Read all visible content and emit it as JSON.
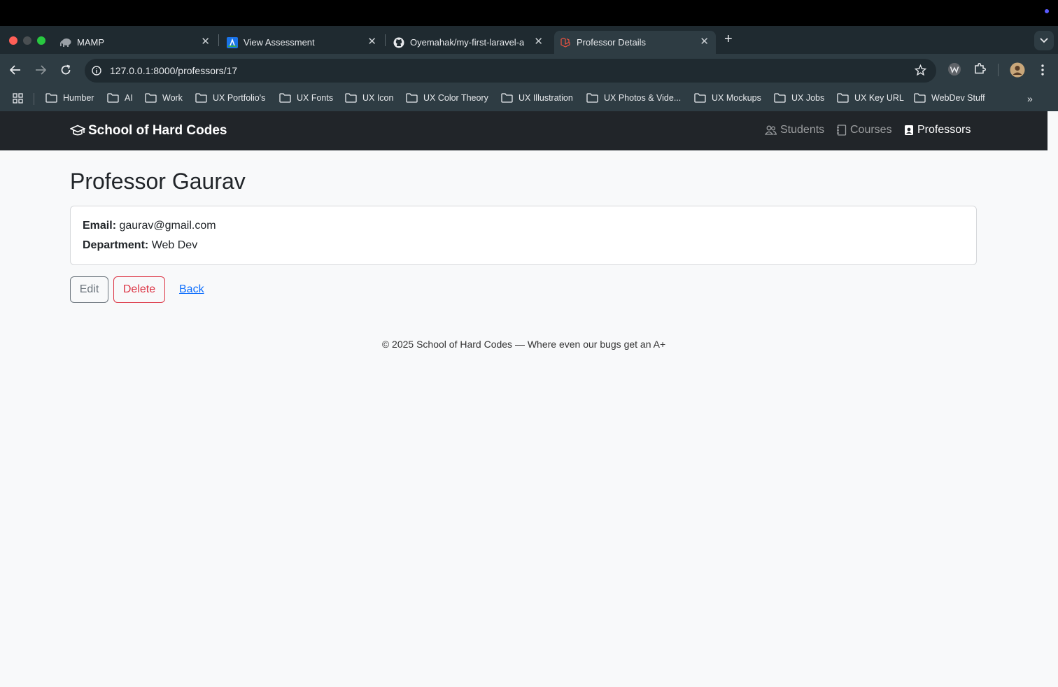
{
  "browser": {
    "tabs": [
      {
        "title": "MAMP",
        "icon": "elephant-icon"
      },
      {
        "title": "View Assessment",
        "icon": "app-icon"
      },
      {
        "title": "Oyemahak/my-first-laravel-a",
        "icon": "github-icon"
      },
      {
        "title": "Professor Details",
        "icon": "laravel-icon"
      }
    ],
    "url": "127.0.0.1:8000/professors/17",
    "bookmarks": [
      "Humber",
      "AI",
      "Work",
      "UX Portfolio's",
      "UX Fonts",
      "UX Icon",
      "UX Color Theory",
      "UX Illustration",
      "UX Photos & Vide...",
      "UX Mockups",
      "UX Jobs",
      "UX Key URL",
      "WebDev Stuff"
    ],
    "colors": {
      "tabstrip": "#1f2a30",
      "toolbar": "#2e3c43"
    }
  },
  "site": {
    "brand": "School of Hard Codes",
    "nav": {
      "students": "Students",
      "courses": "Courses",
      "professors": "Professors"
    }
  },
  "professor": {
    "title": "Professor Gaurav",
    "email_label": "Email:",
    "email": "gaurav@gmail.com",
    "department_label": "Department:",
    "department": "Web Dev"
  },
  "actions": {
    "edit": "Edit",
    "delete": "Delete",
    "back": "Back"
  },
  "footer": "© 2025 School of Hard Codes — Where even our bugs get an A+"
}
